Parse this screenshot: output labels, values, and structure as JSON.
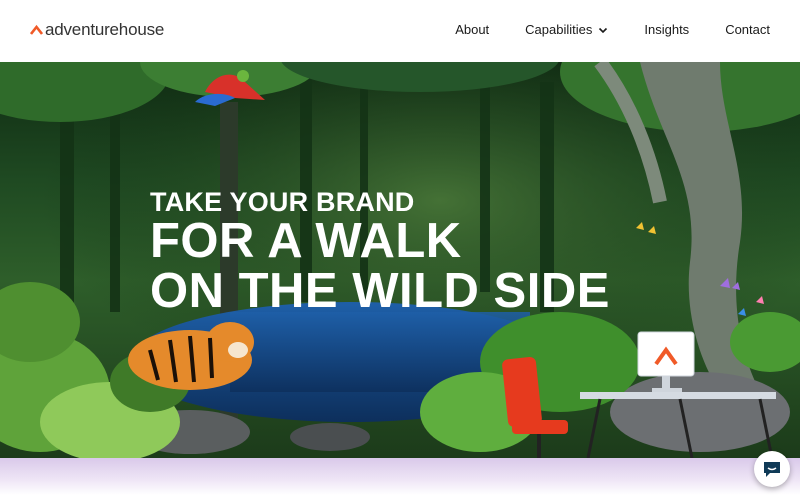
{
  "brand": {
    "name": "adventurehouse",
    "accent_color": "#f05a28"
  },
  "nav": {
    "items": [
      {
        "label": "About"
      },
      {
        "label": "Capabilities",
        "has_dropdown": true
      },
      {
        "label": "Insights"
      },
      {
        "label": "Contact"
      }
    ]
  },
  "hero": {
    "headline_line1": "TAKE YOUR BRAND",
    "headline_line2": "FOR A WALK",
    "headline_line3": "ON THE WILD SIDE"
  },
  "widgets": {
    "chat_icon": "chat-bubble-icon"
  }
}
